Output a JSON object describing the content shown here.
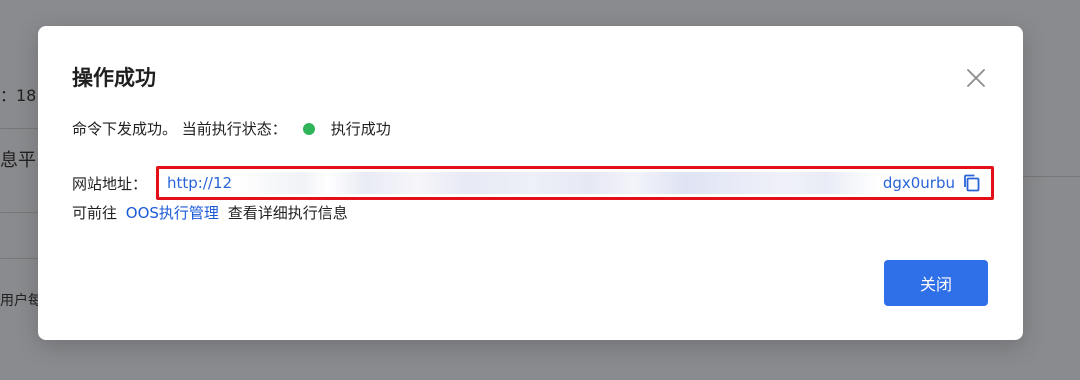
{
  "background": {
    "fragment_1": "：18",
    "fragment_2": "息平",
    "fragment_3": "用户每"
  },
  "modal": {
    "title": "操作成功",
    "status": {
      "prefix": "命令下发成功。 当前执行状态：",
      "value": "执行成功",
      "color": "#2fb45a"
    },
    "website": {
      "label": "网站地址：",
      "url_visible_start": "http://12",
      "url_visible_end": "dgx0urbu"
    },
    "hint": {
      "before": "可前往",
      "link": "OOS执行管理",
      "after": "查看详细执行信息"
    },
    "close_button_label": "关闭"
  },
  "icons": {
    "close": "close-icon",
    "copy": "copy-icon"
  },
  "colors": {
    "primary": "#2f6fe8",
    "link": "#1a5ad8",
    "highlight_border": "#e3101a"
  }
}
